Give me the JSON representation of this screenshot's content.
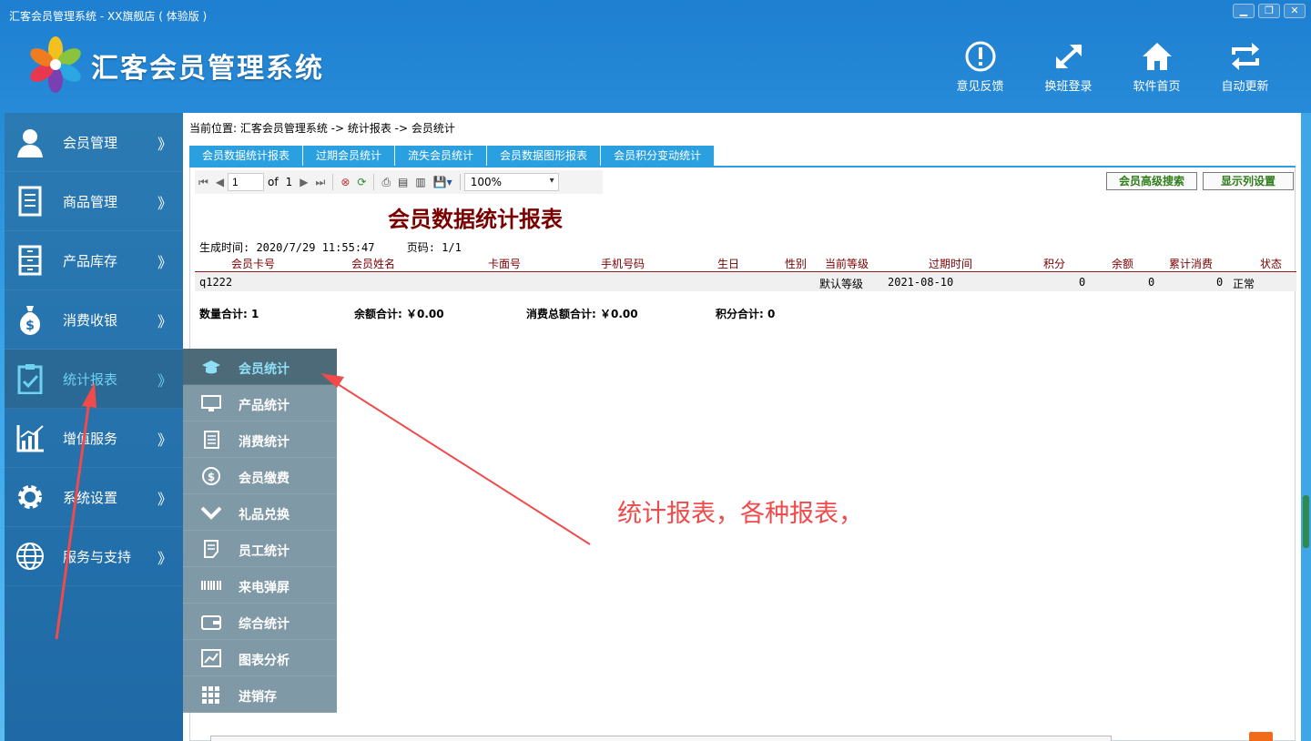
{
  "window": {
    "title": "汇客会员管理系统 - XX旗舰店 ( 体验版 )",
    "minimize": "▁",
    "maximize": "❐",
    "close": "✕"
  },
  "header": {
    "app_title": "汇客会员管理系统",
    "buttons": [
      {
        "label": "意见反馈",
        "icon": "alert-circle-icon"
      },
      {
        "label": "换班登录",
        "icon": "swap-arrows-icon"
      },
      {
        "label": "软件首页",
        "icon": "home-icon"
      },
      {
        "label": "自动更新",
        "icon": "refresh-icon"
      }
    ]
  },
  "sidebar": {
    "arrow": "》",
    "items": [
      {
        "label": "会员管理",
        "icon": "user-icon"
      },
      {
        "label": "商品管理",
        "icon": "document-icon"
      },
      {
        "label": "产品库存",
        "icon": "cabinet-icon"
      },
      {
        "label": "消费收银",
        "icon": "money-bag-icon"
      },
      {
        "label": "统计报表",
        "icon": "clipboard-check-icon",
        "active": true
      },
      {
        "label": "增值服务",
        "icon": "chart-growth-icon"
      },
      {
        "label": "系统设置",
        "icon": "gear-icon"
      },
      {
        "label": "服务与支持",
        "icon": "globe-icon"
      }
    ]
  },
  "submenu": {
    "items": [
      {
        "label": "会员统计",
        "icon": "graduation-cap-icon",
        "active": true
      },
      {
        "label": "产品统计",
        "icon": "monitor-icon"
      },
      {
        "label": "消费统计",
        "icon": "receipt-icon"
      },
      {
        "label": "会员缴费",
        "icon": "dollar-circle-icon"
      },
      {
        "label": "礼品兑换",
        "icon": "check-chevron-icon"
      },
      {
        "label": "员工统计",
        "icon": "note-icon"
      },
      {
        "label": "来电弹屏",
        "icon": "barcode-icon"
      },
      {
        "label": "综合统计",
        "icon": "wallet-icon"
      },
      {
        "label": "图表分析",
        "icon": "line-chart-icon"
      },
      {
        "label": "进销存",
        "icon": "grid-icon"
      }
    ]
  },
  "main": {
    "breadcrumb": "当前位置: 汇客会员管理系统 -> 统计报表 -> 会员统计",
    "tabs": [
      {
        "label": "会员数据统计报表",
        "active": true
      },
      {
        "label": "过期会员统计"
      },
      {
        "label": "流失会员统计"
      },
      {
        "label": "会员数据图形报表"
      },
      {
        "label": "会员积分变动统计"
      }
    ],
    "toolbar": {
      "page_value": "1",
      "of_label": "of",
      "page_total": "1",
      "zoom": "100%"
    },
    "actions": {
      "advanced_search": "会员高级搜索",
      "column_settings": "显示列设置"
    },
    "report": {
      "title": "会员数据统计报表",
      "generated_label": "生成时间: 2020/7/29 11:55:47",
      "page_label": "页码: 1/1",
      "columns": [
        "会员卡号",
        "会员姓名",
        "卡面号",
        "手机号码",
        "生日",
        "性别",
        "当前等级",
        "过期时间",
        "积分",
        "余额",
        "累计消费",
        "状态"
      ],
      "rows": [
        {
          "card": "q1222",
          "name": "",
          "face": "",
          "phone": "",
          "birthday": "",
          "gender": "",
          "level": "默认等级",
          "expire": "2021-08-10",
          "points": "0",
          "balance": "0",
          "total": "0",
          "status": "正常"
        }
      ],
      "totals": {
        "count": "数量合计: 1",
        "balance": "余额合计: ￥0.00",
        "consumption": "消费总额合计: ￥0.00",
        "points": "积分合计: 0"
      }
    }
  },
  "annotation": {
    "text": "统计报表，各种报表，",
    "color": "#f04a4a"
  },
  "colors": {
    "accent": "#2aa0e0",
    "report_title": "#7a0000",
    "sidebar": "#2270ab",
    "submenu": "#7f99a6"
  }
}
